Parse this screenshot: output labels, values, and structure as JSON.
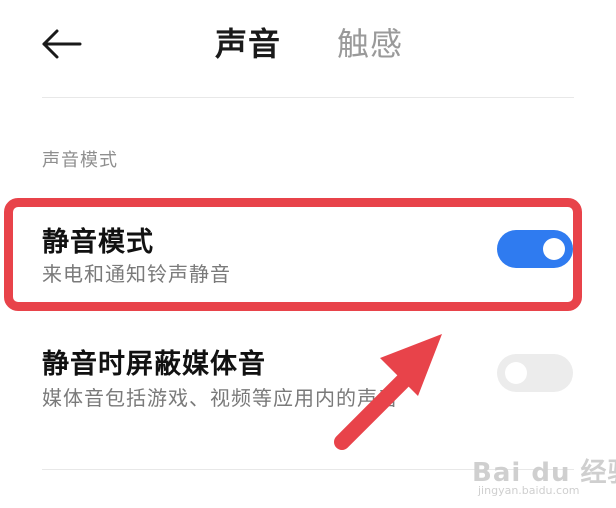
{
  "header": {
    "back_icon": "arrow-left-icon",
    "tabs": [
      {
        "label": "声音",
        "active": true
      },
      {
        "label": "触感",
        "active": false
      }
    ]
  },
  "section": {
    "header": "声音模式",
    "items": [
      {
        "title": "静音模式",
        "subtitle": "来电和通知铃声静音",
        "toggle_on": true
      },
      {
        "title": "静音时屏蔽媒体音",
        "subtitle": "媒体音包括游戏、视频等应用内的声音",
        "toggle_on": false
      }
    ]
  },
  "annotation": {
    "box_color": "#e8434a",
    "arrow_color": "#e8434a"
  },
  "colors": {
    "toggle_on": "#2f7bf0",
    "toggle_off": "#ececec"
  },
  "watermark": {
    "logo": "Bai du 经验",
    "sub": "jingyan.baidu.com"
  }
}
